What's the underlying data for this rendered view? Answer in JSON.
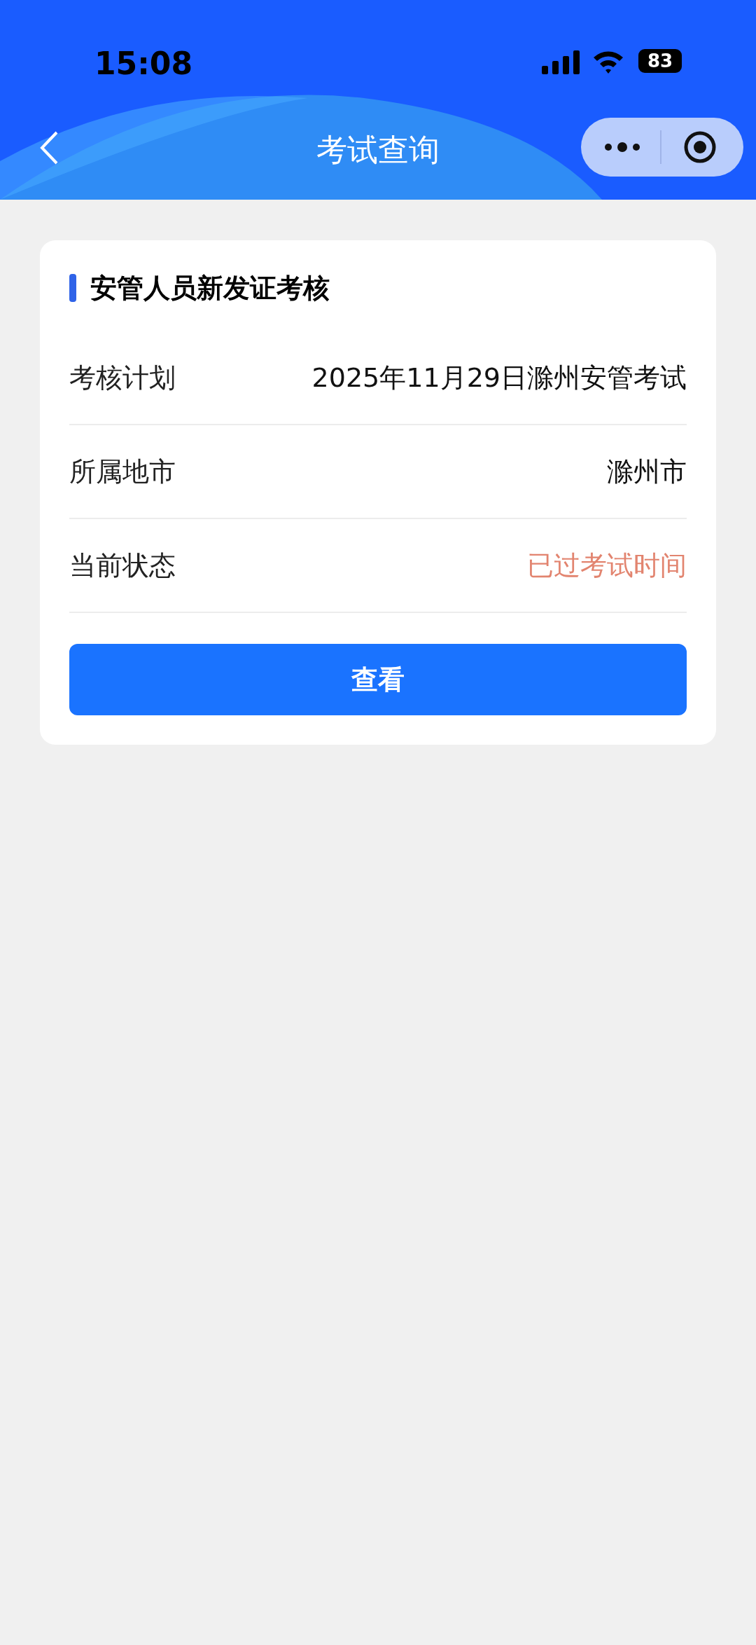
{
  "status_bar": {
    "time": "15:08",
    "battery": "83"
  },
  "nav": {
    "title": "考试查询"
  },
  "card": {
    "title": "安管人员新发证考核",
    "rows": [
      {
        "label": "考核计划",
        "value": "2025年11月29日滁州安管考试",
        "kind": "text"
      },
      {
        "label": "所属地市",
        "value": "滁州市",
        "kind": "text"
      },
      {
        "label": "当前状态",
        "value": "已过考试时间",
        "kind": "status"
      }
    ],
    "button": "查看"
  }
}
